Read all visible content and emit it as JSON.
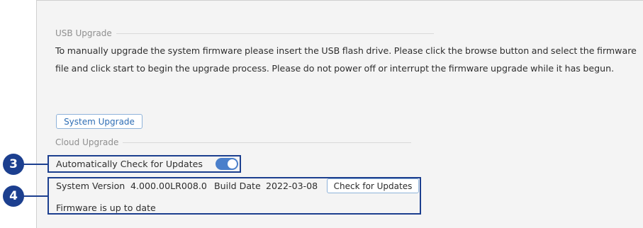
{
  "usb_upgrade": {
    "title": "USB Upgrade",
    "description": "To manually upgrade the system firmware please insert the USB flash drive. Please click the browse button and select the firmware file and click start to begin the upgrade process. Please do not power off or interrupt the firmware upgrade while it has begun.",
    "button_label": "System Upgrade"
  },
  "cloud_upgrade": {
    "title": "Cloud Upgrade",
    "auto_check_label": "Automatically Check for Updates",
    "auto_check_enabled": true,
    "system_version_label": "System Version",
    "system_version_value": "4.000.00LR008.0",
    "build_date_label": "Build Date",
    "build_date_value": "2022-03-08",
    "check_button_label": "Check for Updates",
    "status": "Firmware is up to date"
  },
  "callouts": {
    "callout_3": "3",
    "callout_4": "4"
  },
  "colors": {
    "accent": "#4a7fcb",
    "callout": "#1c3f8f",
    "button_border": "#8fb3da"
  }
}
